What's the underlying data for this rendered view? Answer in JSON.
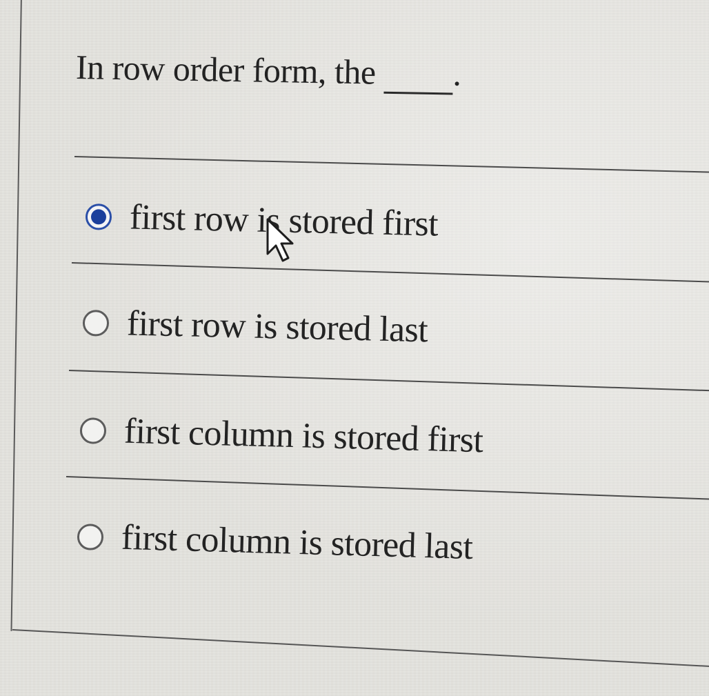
{
  "question": {
    "prompt": "In row order form, the",
    "blank_suffix": "."
  },
  "options": [
    {
      "label": "first row is stored first",
      "selected": true
    },
    {
      "label": "first row is stored last",
      "selected": false
    },
    {
      "label": "first column is stored first",
      "selected": false
    },
    {
      "label": "first column is stored last",
      "selected": false
    }
  ],
  "colors": {
    "selected_radio": "#1b3f9c",
    "background": "#e4e3de",
    "text": "#232323"
  },
  "icons": {
    "cursor": "mouse-pointer-icon"
  }
}
